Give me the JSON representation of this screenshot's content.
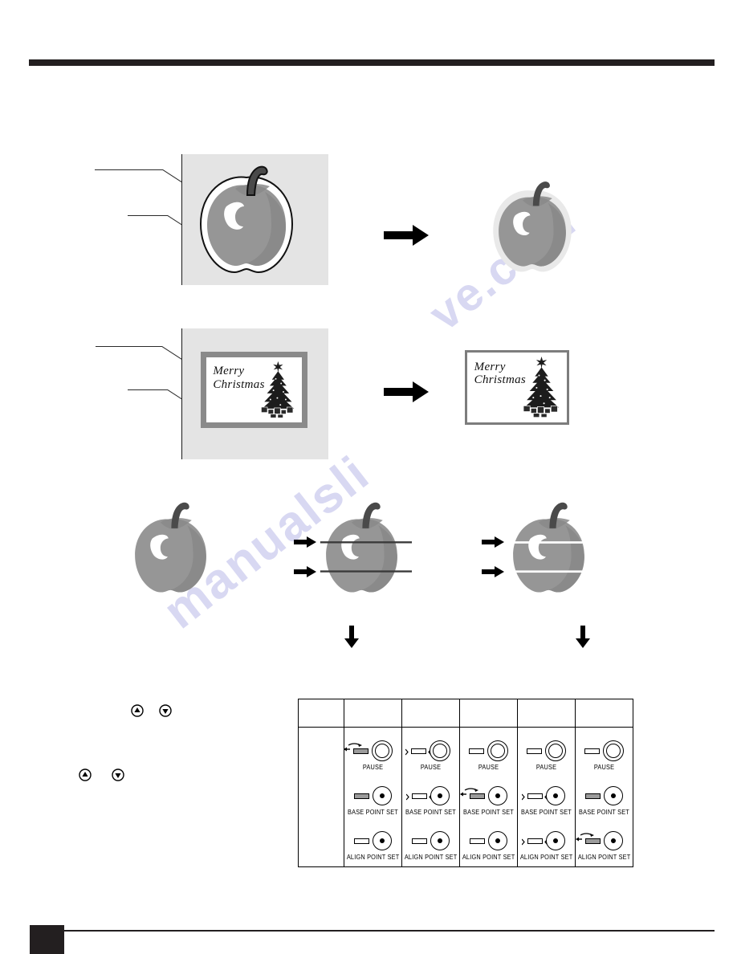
{
  "document": {
    "type": "instruction-manual-page",
    "header_rule": true,
    "footer_rule": true,
    "page_tab": ""
  },
  "watermark": {
    "text_a": "manualsli",
    "text_b": "ve.com"
  },
  "figure_1": {
    "name": "background-removal-apple",
    "source": {
      "label": "",
      "background_color": "#e4e4e4",
      "subject": "apple-illustration"
    },
    "arrow": "→",
    "result": {
      "label": "",
      "background_color": "#ffffff",
      "subject": "apple-illustration"
    },
    "leader_lines": 2
  },
  "figure_2": {
    "name": "background-removal-christmas-card",
    "source": {
      "card_text_line1": "Merry",
      "card_text_line2": "Christmas",
      "ornament": "christmas-tree",
      "background_color": "#e4e4e4",
      "frame_color": "#8a8a8a"
    },
    "arrow": "→",
    "result": {
      "card_text_line1": "Merry",
      "card_text_line2": "Christmas",
      "ornament": "christmas-tree",
      "background_color": "#ffffff",
      "frame_color": "#7d7d7d"
    },
    "leader_lines": 2
  },
  "figure_3": {
    "name": "scan-line-selection",
    "apples": [
      {
        "label": "",
        "lines": "none",
        "line_color": ""
      },
      {
        "label": "",
        "lines": "two-horizontal",
        "line_color": "#3a3a3a",
        "arrows": 2
      },
      {
        "label": "",
        "lines": "two-horizontal",
        "line_color": "#ffffff",
        "arrows": 2
      }
    ],
    "down_arrows": 2
  },
  "stepper_buttons": [
    {
      "name": "up-button-top",
      "glyph": "▲"
    },
    {
      "name": "down-button-top",
      "glyph": "▼"
    },
    {
      "name": "up-button-bottom",
      "glyph": "▲"
    },
    {
      "name": "down-button-bottom",
      "glyph": "▼"
    }
  ],
  "panel_table": {
    "columns": 6,
    "header_row": [
      "",
      "",
      "",
      "",
      "",
      ""
    ],
    "first_column_label": "",
    "cells": [
      {
        "column": 1,
        "buttons": [
          {
            "label": "PAUSE",
            "indicator": "blinking",
            "knob": "ring"
          },
          {
            "label": "BASE POINT SET",
            "indicator": "on",
            "knob": "dot"
          },
          {
            "label": "ALIGN POINT SET",
            "indicator": "off",
            "knob": "dot"
          }
        ]
      },
      {
        "column": 2,
        "buttons": [
          {
            "label": "PAUSE",
            "indicator": "lit",
            "knob": "ring"
          },
          {
            "label": "BASE POINT SET",
            "indicator": "lit",
            "knob": "dot"
          },
          {
            "label": "ALIGN POINT SET",
            "indicator": "off",
            "knob": "dot"
          }
        ]
      },
      {
        "column": 3,
        "buttons": [
          {
            "label": "PAUSE",
            "indicator": "off",
            "knob": "ring"
          },
          {
            "label": "BASE POINT SET",
            "indicator": "blinking",
            "knob": "dot"
          },
          {
            "label": "ALIGN POINT SET",
            "indicator": "off",
            "knob": "dot"
          }
        ]
      },
      {
        "column": 4,
        "buttons": [
          {
            "label": "PAUSE",
            "indicator": "off",
            "knob": "ring"
          },
          {
            "label": "BASE POINT SET",
            "indicator": "lit",
            "knob": "dot"
          },
          {
            "label": "ALIGN POINT SET",
            "indicator": "lit",
            "knob": "dot"
          }
        ]
      },
      {
        "column": 5,
        "buttons": [
          {
            "label": "PAUSE",
            "indicator": "off",
            "knob": "ring"
          },
          {
            "label": "BASE POINT SET",
            "indicator": "on",
            "knob": "dot"
          },
          {
            "label": "ALIGN POINT SET",
            "indicator": "blinking",
            "knob": "dot"
          }
        ]
      }
    ]
  },
  "colors": {
    "rule": "#231f20",
    "apple_body": "#969696",
    "apple_shadow": "#878787",
    "apple_stem": "#4a4a4a",
    "apple_highlight": "#ffffff",
    "box_background": "#e4e4e4",
    "card_frame": "#8a8a8a",
    "watermark": "#b9b9e8"
  }
}
